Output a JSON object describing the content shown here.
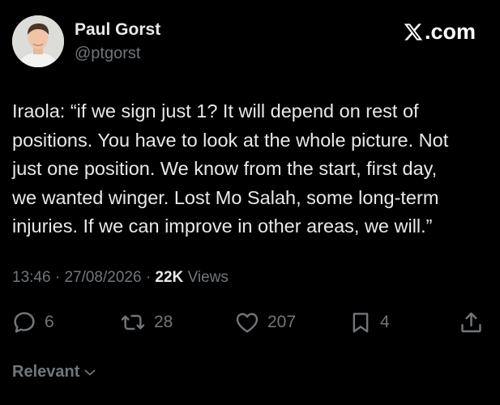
{
  "author": {
    "display_name": "Paul Gorst",
    "handle": "@ptgorst"
  },
  "brand": {
    "logo_text": ".com",
    "icon": "x-logo-icon"
  },
  "tweet": {
    "text": "Iraola: “if we sign just 1? It will depend on rest of\npositions. You have to look at the whole picture. Not\njust one position. We know from the start, first day,\nwe wanted winger. Lost Mo Salah, some long-term\ninjuries. If we can improve in other areas, we will.”"
  },
  "meta": {
    "time": "13:46",
    "separator": "·",
    "date": "27/08/2026",
    "views_count": "22K",
    "views_label": "Views"
  },
  "actions": {
    "reply_count": "6",
    "repost_count": "28",
    "like_count": "207",
    "bookmark_count": "4"
  },
  "replies_sort": {
    "label": "Relevant"
  },
  "colors": {
    "background": "#000000",
    "primary_text": "#e7e9ea",
    "secondary_text": "#71767b"
  }
}
